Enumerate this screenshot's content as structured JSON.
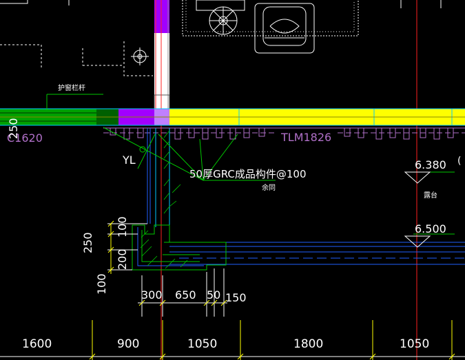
{
  "drawing": {
    "labels": {
      "railing_note": "护窗栏杆",
      "window_c1620": "C1620",
      "window_tlm1826": "TLM1826",
      "yl": "YL",
      "grc_note": "50厚GRC成品构件@100",
      "grc_sub": "余同",
      "elev_top": "6.380",
      "paren": "(",
      "balcony": "露台",
      "elev_bottom": "6.500"
    },
    "dims": {
      "left_250_top": "250",
      "left_100_a": "100",
      "left_250_b": "250",
      "left_200": "200",
      "left_100_b": "100",
      "d300": "300",
      "d650": "650",
      "d50": "50",
      "d150": "150"
    },
    "axis_spacings": [
      "1600",
      "900",
      "1050",
      "1800",
      "1050"
    ]
  },
  "colors": {
    "background": "#000000",
    "white": "#ffffff",
    "yellow": "#ffff00",
    "green": "#00c800",
    "cyan": "#00c8ff",
    "purple": "#a100ff",
    "magenta_text": "#b070c8",
    "red_axis": "#ff2020",
    "blue_line": "#2060ff"
  }
}
